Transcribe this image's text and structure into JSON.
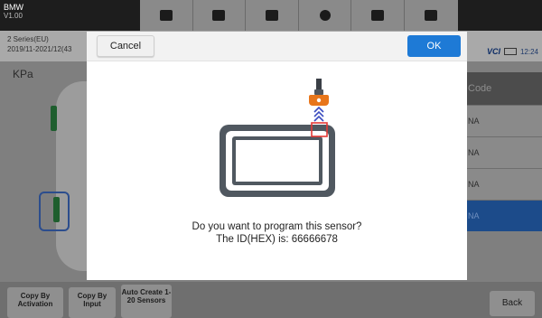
{
  "app": {
    "brand": "BMW",
    "version": "V1.00"
  },
  "toolbar": {
    "icons": [
      "home-icon",
      "vehicle-swap-icon",
      "print-icon",
      "help-icon",
      "save-icon",
      "feedback-icon"
    ]
  },
  "vehicle": {
    "model": "2 Series(EU)",
    "date_range": "2019/11-2021/12(43"
  },
  "status": {
    "vci_label": "VCI",
    "time": "12:24"
  },
  "unit_label": "KPa",
  "sensor_list": {
    "header": "Code",
    "rows": [
      "NA",
      "NA",
      "NA",
      "NA"
    ],
    "active_index": 3
  },
  "bottom_buttons": {
    "copy_by_activation": "Copy By Activation",
    "copy_by_input": "Copy By Input",
    "auto_create": "Auto Create 1-20 Sensors",
    "back": "Back"
  },
  "dialog": {
    "cancel_label": "Cancel",
    "ok_label": "OK",
    "question": "Do you want to program this sensor?",
    "id_line": "The ID(HEX) is: 66666678"
  },
  "colors": {
    "ok_button": "#1e7ad6",
    "sensor_orange": "#e8761b",
    "highlight_red": "#e53935",
    "tablet_body": "#505860",
    "signal_arrows": "#3b4cc0"
  }
}
